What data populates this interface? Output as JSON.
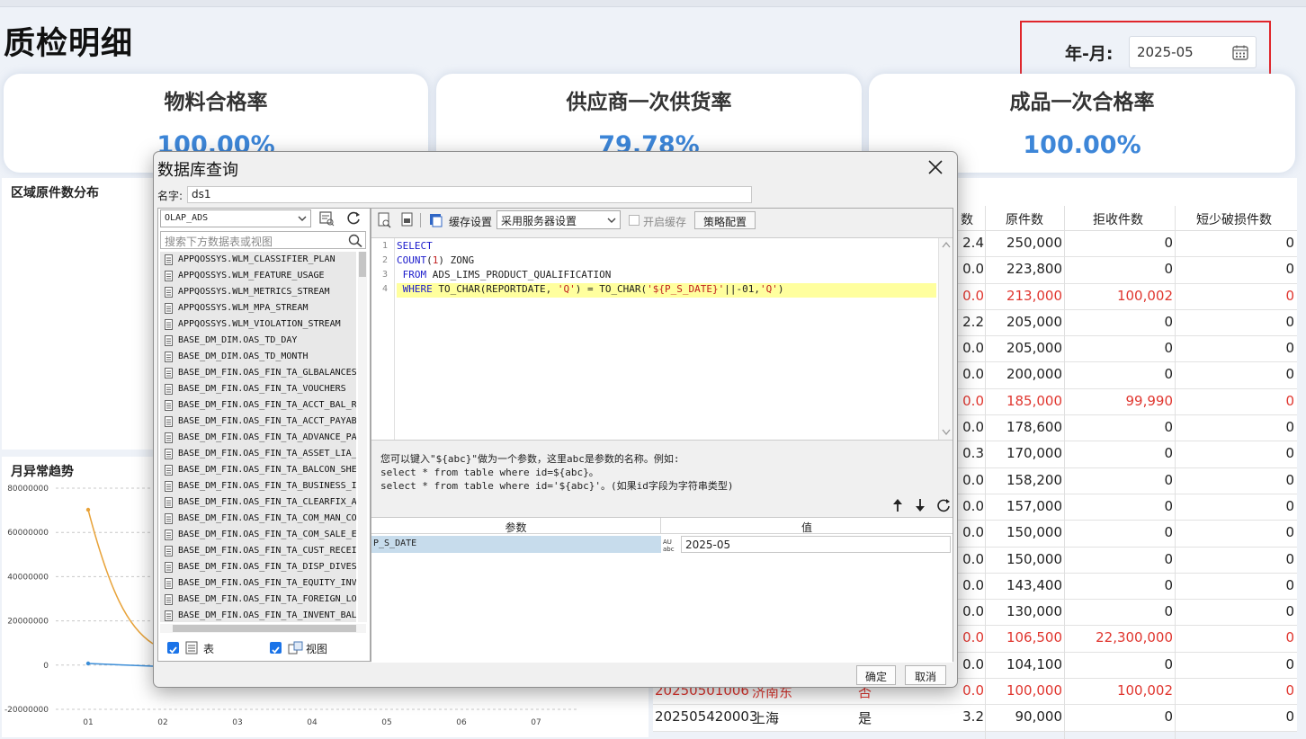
{
  "page": {
    "title": "质检明细",
    "ym_label": "年-月:",
    "ym_value": "2025-05"
  },
  "kpis": [
    {
      "title": "物料合格率",
      "value": "100.00%"
    },
    {
      "title": "供应商一次供货率",
      "value": "79.78%"
    },
    {
      "title": "成品一次合格率",
      "value": "100.00%"
    }
  ],
  "region_panel": {
    "title": "区域原件数分布"
  },
  "trend": {
    "title": "月异常趋势",
    "y_ticks": [
      "80000000",
      "60000000",
      "40000000",
      "20000000",
      "0",
      "-20000000"
    ],
    "x_ticks": [
      "01",
      "02",
      "03",
      "04",
      "05",
      "06",
      "07"
    ]
  },
  "table": {
    "headers": [
      "数",
      "原件数",
      "拒收件数",
      "短少破损件数"
    ],
    "rows": [
      {
        "c0": "",
        "c1": "",
        "c2": "",
        "c3": "2.4",
        "c4": "250,000",
        "c5": "0",
        "c6": "0",
        "red": false
      },
      {
        "c0": "",
        "c1": "",
        "c2": "",
        "c3": "0.0",
        "c4": "223,800",
        "c5": "0",
        "c6": "0",
        "red": false
      },
      {
        "c0": "",
        "c1": "",
        "c2": "",
        "c3": "0.0",
        "c4": "213,000",
        "c5": "100,002",
        "c6": "0",
        "red": true
      },
      {
        "c0": "",
        "c1": "",
        "c2": "",
        "c3": "2.2",
        "c4": "205,000",
        "c5": "0",
        "c6": "0",
        "red": false
      },
      {
        "c0": "",
        "c1": "",
        "c2": "",
        "c3": "0.0",
        "c4": "205,000",
        "c5": "0",
        "c6": "0",
        "red": false
      },
      {
        "c0": "",
        "c1": "",
        "c2": "",
        "c3": "0.0",
        "c4": "200,000",
        "c5": "0",
        "c6": "0",
        "red": false
      },
      {
        "c0": "",
        "c1": "",
        "c2": "",
        "c3": "0.0",
        "c4": "185,000",
        "c5": "99,990",
        "c6": "0",
        "red": true
      },
      {
        "c0": "",
        "c1": "",
        "c2": "",
        "c3": "0.0",
        "c4": "178,600",
        "c5": "0",
        "c6": "0",
        "red": false
      },
      {
        "c0": "",
        "c1": "",
        "c2": "",
        "c3": "0.3",
        "c4": "170,000",
        "c5": "0",
        "c6": "0",
        "red": false
      },
      {
        "c0": "",
        "c1": "",
        "c2": "",
        "c3": "0.0",
        "c4": "158,200",
        "c5": "0",
        "c6": "0",
        "red": false
      },
      {
        "c0": "",
        "c1": "",
        "c2": "",
        "c3": "0.0",
        "c4": "157,000",
        "c5": "0",
        "c6": "0",
        "red": false
      },
      {
        "c0": "",
        "c1": "",
        "c2": "",
        "c3": "0.0",
        "c4": "150,000",
        "c5": "0",
        "c6": "0",
        "red": false
      },
      {
        "c0": "",
        "c1": "",
        "c2": "",
        "c3": "0.0",
        "c4": "150,000",
        "c5": "0",
        "c6": "0",
        "red": false
      },
      {
        "c0": "",
        "c1": "",
        "c2": "",
        "c3": "0.0",
        "c4": "143,400",
        "c5": "0",
        "c6": "0",
        "red": false
      },
      {
        "c0": "",
        "c1": "",
        "c2": "",
        "c3": "0.0",
        "c4": "130,000",
        "c5": "0",
        "c6": "0",
        "red": false
      },
      {
        "c0": "",
        "c1": "",
        "c2": "",
        "c3": "0.0",
        "c4": "106,500",
        "c5": "22,300,000",
        "c6": "0",
        "red": true
      },
      {
        "c0": "",
        "c1": "",
        "c2": "",
        "c3": "0.0",
        "c4": "104,100",
        "c5": "0",
        "c6": "0",
        "red": false
      },
      {
        "c0": "20250501006",
        "c1": "济南东",
        "c2": "否",
        "c3": "0.0",
        "c4": "100,000",
        "c5": "100,002",
        "c6": "0",
        "red": true
      },
      {
        "c0": "202505420003",
        "c1": "上海",
        "c2": "是",
        "c3": "3.2",
        "c4": "90,000",
        "c5": "0",
        "c6": "0",
        "red": false
      }
    ]
  },
  "dialog": {
    "title": "数据库查询",
    "name_label": "名字:",
    "name_value": "ds1",
    "datasource": "OLAP_ADS",
    "search_placeholder": "搜索下方数据表或视图",
    "tables": [
      "APPQOSSYS.WLM_CLASSIFIER_PLAN",
      "APPQOSSYS.WLM_FEATURE_USAGE",
      "APPQOSSYS.WLM_METRICS_STREAM",
      "APPQOSSYS.WLM_MPA_STREAM",
      "APPQOSSYS.WLM_VIOLATION_STREAM",
      "BASE_DM_DIM.OAS_TD_DAY",
      "BASE_DM_DIM.OAS_TD_MONTH",
      "BASE_DM_FIN.OAS_FIN_TA_GLBALANCES",
      "BASE_DM_FIN.OAS_FIN_TA_VOUCHERS",
      "BASE_DM_FIN.OAS_FIN_TA_ACCT_BAL_R",
      "BASE_DM_FIN.OAS_FIN_TA_ACCT_PAYAB",
      "BASE_DM_FIN.OAS_FIN_TA_ADVANCE_PA",
      "BASE_DM_FIN.OAS_FIN_TA_ASSET_LIA_",
      "BASE_DM_FIN.OAS_FIN_TA_BALCON_SHE",
      "BASE_DM_FIN.OAS_FIN_TA_BUSINESS_I",
      "BASE_DM_FIN.OAS_FIN_TA_CLEARFIX_A",
      "BASE_DM_FIN.OAS_FIN_TA_COM_MAN_CO",
      "BASE_DM_FIN.OAS_FIN_TA_COM_SALE_E",
      "BASE_DM_FIN.OAS_FIN_TA_CUST_RECEI",
      "BASE_DM_FIN.OAS_FIN_TA_DISP_DIVES",
      "BASE_DM_FIN.OAS_FIN_TA_EQUITY_INV",
      "BASE_DM_FIN.OAS_FIN_TA_FOREIGN_LO",
      "BASE_DM_FIN.OAS_FIN_TA_INVENT_BAL"
    ],
    "check_table_label": "表",
    "check_view_label": "视图",
    "cache_label": "缓存设置",
    "cache_option": "采用服务器设置",
    "enable_cache_label": "开启缓存",
    "policy_button": "策略配置",
    "sql_lines": [
      {
        "n": "1",
        "parts": [
          {
            "t": "SELECT",
            "k": "kw"
          }
        ]
      },
      {
        "n": "2",
        "parts": [
          {
            "t": "COUNT",
            "k": "kw"
          },
          {
            "t": "(",
            "k": ""
          },
          {
            "t": "1",
            "k": "str"
          },
          {
            "t": ") ZONG",
            "k": ""
          }
        ]
      },
      {
        "n": "3",
        "parts": [
          {
            "t": " FROM",
            "k": "kw"
          },
          {
            "t": " ADS_LIMS_PRODUCT_QUALIFICATION",
            "k": ""
          }
        ]
      },
      {
        "n": "4",
        "parts": [
          {
            "t": " WHERE",
            "k": "kw"
          },
          {
            "t": " TO_CHAR(REPORTDATE, ",
            "k": ""
          },
          {
            "t": "'Q'",
            "k": "str"
          },
          {
            "t": ") = TO_CHAR(",
            "k": ""
          },
          {
            "t": "'${P_S_DATE}'",
            "k": "str"
          },
          {
            "t": "||-01,",
            "k": ""
          },
          {
            "t": "'Q'",
            "k": "str"
          },
          {
            "t": ")",
            "k": ""
          }
        ]
      }
    ],
    "hint_line1": "您可以键入\"${abc}\"做为一个参数，这里abc是参数的名称。例如:",
    "hint_line2": "select * from table where id=${abc}。",
    "hint_line3": "select * from table where id='${abc}'。(如果id字段为字符串类型)",
    "param_header": "参数",
    "value_header": "值",
    "param_name": "P_S_DATE",
    "param_value": "2025-05",
    "ok_button": "确定",
    "cancel_button": "取消"
  },
  "colors": {
    "accent": "#3d86d8",
    "alert": "#e0362f",
    "highlight": "#e0262b",
    "trend_line": "#e8a33a",
    "trend_line2": "#3c8ed8"
  }
}
